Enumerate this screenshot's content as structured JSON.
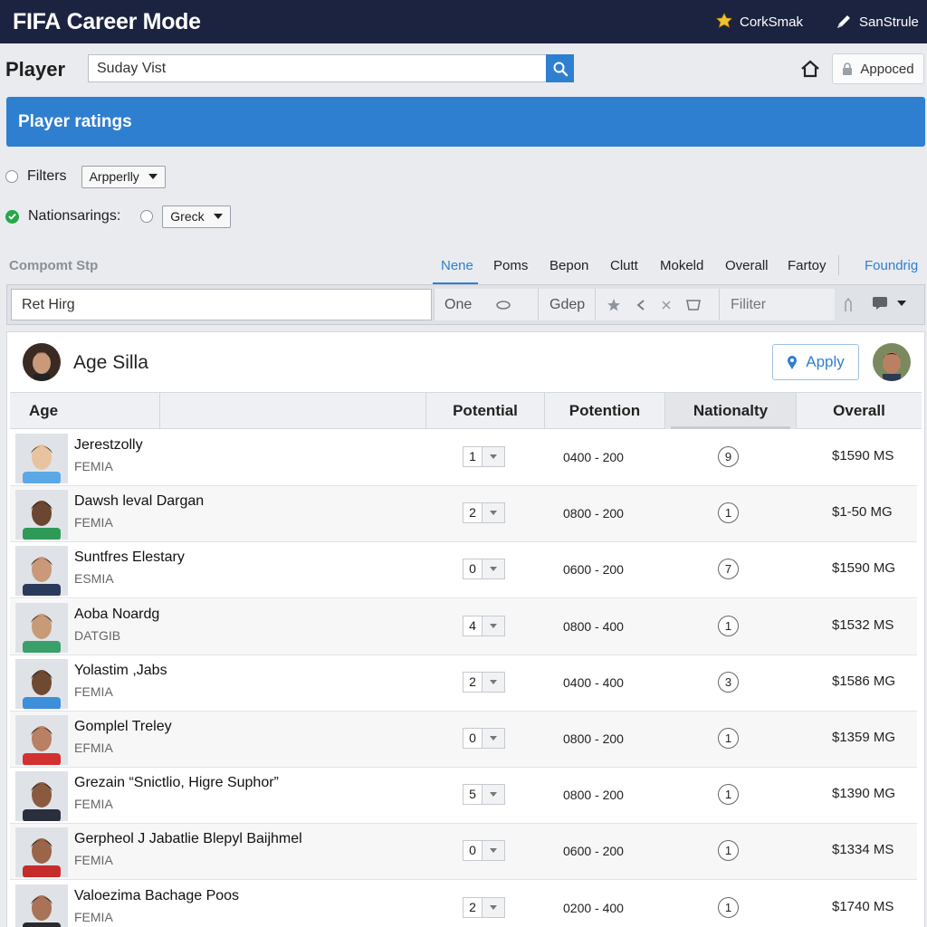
{
  "app": {
    "title_prefix": "FIFA",
    "title_rest": " Career Mode",
    "actions": [
      {
        "label": "CorkSmak",
        "icon": "puzzle-icon"
      },
      {
        "label": "SanStrule",
        "icon": "pen-icon"
      }
    ]
  },
  "search": {
    "page_label": "Player",
    "value": "Suday Vist",
    "approved_label": "Appoced"
  },
  "banner": {
    "title": "Player ratings"
  },
  "filters": {
    "filters_label": "Filters",
    "filters_select": "Arpperlly",
    "nations_label": "Nationsarings:",
    "nations_select": "Greck"
  },
  "tabs": {
    "section_label": "Compomt Stp",
    "items": [
      "Nene",
      "Poms",
      "Bepon",
      "Clutt",
      "Mokeld",
      "Overall",
      "Fartoy"
    ],
    "link": "Foundrig"
  },
  "toolbar": {
    "query": "Ret Hirg",
    "seg1": "One",
    "seg2": "Gdep",
    "filter_placeholder": "Filiter"
  },
  "card": {
    "title": "Age Silla",
    "apply_label": "Apply"
  },
  "table": {
    "headers": [
      "Age",
      "Potential",
      "Potention",
      "Nationalty",
      "Overall"
    ],
    "rows": [
      {
        "name": "Jerestzolly",
        "club": "FEMIA",
        "step": "1",
        "range": "0400 - 200",
        "nat": "9",
        "price": "$1590 MS",
        "shirt": "#5aa9e6",
        "skin": "#e8c3a0",
        "hair": "#4a3a2a"
      },
      {
        "name": "Dawsh leval Dargan",
        "club": "FEMIA",
        "step": "2",
        "range": "0800 - 200",
        "nat": "1",
        "price": "$1-50 MG",
        "shirt": "#2e9a58",
        "skin": "#6b4630",
        "hair": "#1b1410"
      },
      {
        "name": "Suntfres Elestary",
        "club": "ESMIA",
        "step": "0",
        "range": "0600 - 200",
        "nat": "7",
        "price": "$1590 MG",
        "shirt": "#2b3a5a",
        "skin": "#c9997a",
        "hair": "#2a1e18"
      },
      {
        "name": "Aoba Noardg",
        "club": "DATGIB",
        "step": "4",
        "range": "0800 - 400",
        "nat": "1",
        "price": "$1532 MS",
        "shirt": "#3aa06a",
        "skin": "#c79a78",
        "hair": "#2d2420"
      },
      {
        "name": "Yolastim ,Jabs",
        "club": "FEMIA",
        "step": "2",
        "range": "0400 - 400",
        "nat": "3",
        "price": "$1586 MG",
        "shirt": "#3c8fd8",
        "skin": "#6f4a33",
        "hair": "#161010"
      },
      {
        "name": "Gomplel Treley",
        "club": "EFMIA",
        "step": "0",
        "range": "0800 - 200",
        "nat": "1",
        "price": "$1359 MG",
        "shirt": "#d33030",
        "skin": "#b98063",
        "hair": "#1f1612"
      },
      {
        "name": "Grezain “Snictlio, Higre Suphor”",
        "club": "FEMIA",
        "step": "5",
        "range": "0800 - 200",
        "nat": "1",
        "price": "$1390 MG",
        "shirt": "#2a2f3d",
        "skin": "#8a5a40",
        "hair": "#1a1210"
      },
      {
        "name": "Gerpheol J Jabatlie Blepyl Baijhmel",
        "club": "FEMIA",
        "step": "0",
        "range": "0600 - 200",
        "nat": "1",
        "price": "$1334 MS",
        "shirt": "#c62c2c",
        "skin": "#9a6548",
        "hair": "#1d1511"
      },
      {
        "name": "Valoezima Bachage Poos",
        "club": "FEMIA",
        "step": "2",
        "range": "0200 - 400",
        "nat": "1",
        "price": "$1740 MS",
        "shirt": "#2b2b2f",
        "skin": "#a87356",
        "hair": "#1a1311"
      }
    ]
  },
  "colors": {
    "topbar": "#1c2340",
    "accent": "#2f7fd0",
    "success": "#27a74a"
  }
}
